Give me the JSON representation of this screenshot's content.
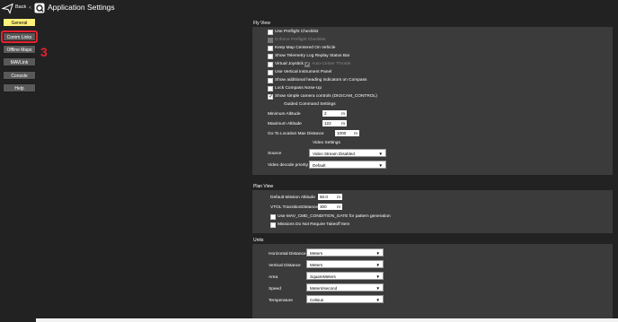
{
  "header": {
    "back_label": "Back",
    "separator": "<",
    "title": "Application Settings"
  },
  "nav": [
    {
      "label": "General"
    },
    {
      "label": "Comm Links"
    },
    {
      "label": "Offline Maps"
    },
    {
      "label": "MAVLink"
    },
    {
      "label": "Console"
    },
    {
      "label": "Help"
    }
  ],
  "annotation": "3",
  "fly_view": {
    "title": "Fly View",
    "checkboxes": [
      {
        "label": "Use Preflight Checklist",
        "checked": false,
        "enabled": true
      },
      {
        "label": "Enforce Preflight Checklist",
        "checked": false,
        "enabled": false
      },
      {
        "label": "Keep Map Centered On Vehicle",
        "checked": false,
        "enabled": true
      },
      {
        "label": "Show Telemetry Log Replay Status Bar",
        "checked": false,
        "enabled": true
      },
      {
        "label": "Virtual Joystick",
        "checked": false,
        "enabled": true
      },
      {
        "label": "Use Vertical Instrument Panel",
        "checked": false,
        "enabled": true
      },
      {
        "label": "Show additional heading indicators on Compass",
        "checked": false,
        "enabled": true
      },
      {
        "label": "Lock Compass Nose-Up",
        "checked": false,
        "enabled": true
      },
      {
        "label": "Show simple camera controls (DIGICAM_CONTROL)",
        "checked": true,
        "enabled": true
      }
    ],
    "auto_center_throttle": "Auto-Center Throttle",
    "guided_title": "Guided Command Settings",
    "guided": [
      {
        "label": "Minimum Altitude",
        "value": "2",
        "unit": "m"
      },
      {
        "label": "Maximum Altitude",
        "value": "122",
        "unit": "m"
      },
      {
        "label": "Go To Location Max Distance",
        "value": "1000",
        "unit": "m"
      }
    ],
    "video_title": "Video Settings",
    "video_source_label": "Source",
    "video_source": "Video Stream Disabled",
    "decode_label": "Video decode priority",
    "decode_value": "Default"
  },
  "plan_view": {
    "title": "Plan View",
    "fields": [
      {
        "label": "Default Mission Altitude",
        "value": "50.0",
        "unit": "m"
      },
      {
        "label": "VTOL TransitionDistance",
        "value": "300",
        "unit": "m"
      }
    ],
    "checkboxes": [
      {
        "label": "Use MAV_CMD_CONDITION_GATE for pattern generation",
        "checked": false
      },
      {
        "label": "Missions Do Not Require Takeoff Item",
        "checked": false
      }
    ]
  },
  "units": {
    "title": "Units",
    "rows": [
      {
        "label": "Horizontal Distance",
        "value": "Meters"
      },
      {
        "label": "Vertical Distance",
        "value": "Meters"
      },
      {
        "label": "Area",
        "value": "SquareMeters"
      },
      {
        "label": "Speed",
        "value": "Meters/second"
      },
      {
        "label": "Temperature",
        "value": "Celsius"
      }
    ]
  },
  "colors": {
    "background": "#222222",
    "panel": "#3b3b3b",
    "active_nav": "#fff17a",
    "highlight": "#e8212e"
  }
}
